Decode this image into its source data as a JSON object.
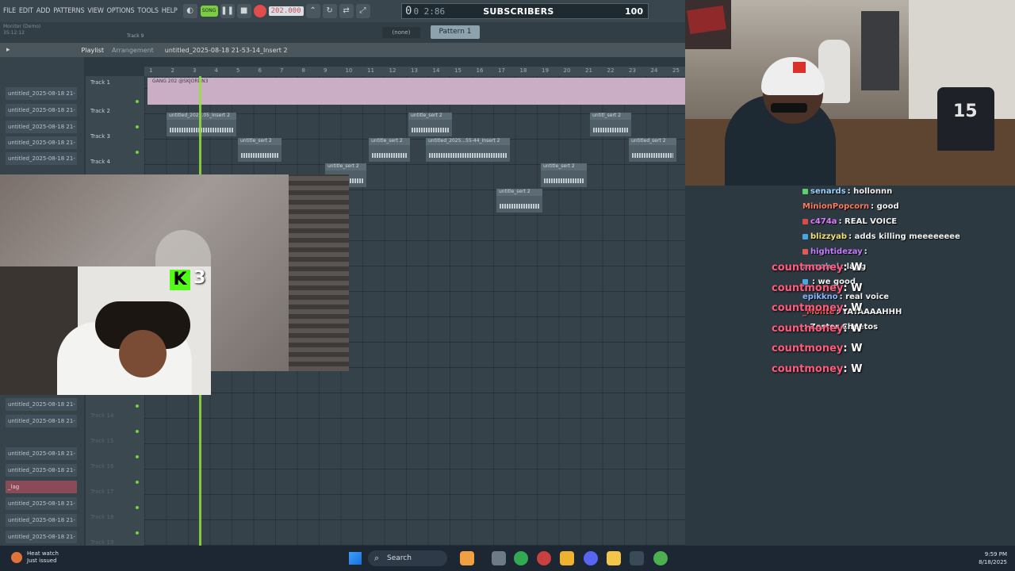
{
  "menu": [
    "FILE",
    "EDIT",
    "ADD",
    "PATTERNS",
    "VIEW",
    "OPTIONS",
    "TOOLS",
    "HELP"
  ],
  "transport": {
    "song_label": "SONG",
    "bpm": "202.000",
    "time_main": "0",
    "time_sub": "0 2:86",
    "subscribers_label": "SUBSCRIBERS",
    "volume": "100"
  },
  "toolbar2": {
    "hint_line1": "Monitor (Demo)",
    "hint_line2": "35:12:12",
    "track_hint": "Track 9",
    "none_select": "(none)",
    "pattern_select": "Pattern 1"
  },
  "playlist": {
    "title": "Playlist",
    "subtitle": "Arrangement",
    "file": "untitled_2025-08-18 21-53-14_Insert 2",
    "track1_clip": "GANG 202 @SKJORDN3"
  },
  "ruler": [
    "1",
    "2",
    "3",
    "4",
    "5",
    "6",
    "7",
    "8",
    "9",
    "10",
    "11",
    "12",
    "13",
    "14",
    "15",
    "16",
    "17",
    "18",
    "19",
    "20",
    "21",
    "22",
    "23",
    "24",
    "25"
  ],
  "browser": {
    "top_items": [
      "untitled_2025-08-18 21-",
      "untitled_2025-08-18 21-",
      "untitled_2025-08-18 21-",
      "untitled_2025-08-18 21-",
      "untitled_2025-08-18 21-",
      "untitled_2025-08-18 21-"
    ],
    "bottom_items": [
      "untitled_2025-08-18 21-",
      "untitled_2025-08-18 21-",
      "untitled_2025-08-18 21-",
      "untitled_2025-08-18 21-",
      "_lag",
      "untitled_2025-08-18 21-",
      "untitled_2025-08-18 21-",
      "untitled_2025-08-18 21-"
    ]
  },
  "tracks": {
    "visible": [
      "Track 1",
      "Track 2",
      "Track 3",
      "Track 4"
    ],
    "dim": [
      "Track 14",
      "Track 15",
      "Track 16",
      "Track 17",
      "Track 18",
      "Track 19"
    ]
  },
  "clips": [
    {
      "name": "untitled_202...05_Insert 2"
    },
    {
      "name": "untitle_sert 2"
    },
    {
      "name": "untitl_sert 2"
    },
    {
      "name": "untitle_sert 2"
    },
    {
      "name": "untitle_sert 2"
    },
    {
      "name": "untitled_2025...55-44_Insert 2"
    },
    {
      "name": "untitled_sert 2"
    },
    {
      "name": "untitle_sert 2"
    },
    {
      "name": "untitle_sert 2"
    },
    {
      "name": "untitle_sert 2"
    }
  ],
  "webcam": {
    "jersey_number": "15"
  },
  "kick": {
    "logo": "K",
    "viewers": "3"
  },
  "chat": [
    {
      "user": "senards",
      "msg": "hollonnn",
      "color": "#9ad2ff",
      "badge": "#5bd16d"
    },
    {
      "user": "MinionPopcorn",
      "msg": "good",
      "color": "#ff7a5c",
      "badge": ""
    },
    {
      "user": "c474a",
      "msg": "REAL VOICE",
      "color": "#e07cff",
      "badge": "#d94a4a"
    },
    {
      "user": "blizzyab",
      "msg": "adds killing meeeeeeee",
      "color": "#f5e070",
      "badge": "#4aa6e0"
    },
    {
      "user": "hightidezay",
      "msg": "",
      "color": "#c57cff",
      "badge": "#e05a5a"
    },
    {
      "user": "rcruzbol",
      "msg": "lagg",
      "color": "#7fb6ff",
      "badge": ""
    },
    {
      "user": "",
      "msg": "we good",
      "color": "#ff6a6a",
      "badge": "#4aa6e0"
    },
    {
      "user": "epikkno",
      "msg": "real voice",
      "color": "#8ab4ff",
      "badge": ""
    },
    {
      "user": "_Monte",
      "msg": "YAYAAAAHHH",
      "color": "#ff6060",
      "badge": ""
    },
    {
      "user": "",
      "msg": "Zester Cheetos",
      "color": "#5ad17a",
      "badge": ""
    }
  ],
  "w_feed": [
    {
      "user": "countmoney",
      "msg": ": W"
    },
    {
      "user": "countmoney",
      "msg": ": W"
    },
    {
      "user": "countmoney",
      "msg": ": W"
    },
    {
      "user": "countmoney",
      "msg": ": W"
    },
    {
      "user": "countmoney",
      "msg": ": W"
    },
    {
      "user": "countmoney",
      "msg": ": W"
    }
  ],
  "taskbar": {
    "weather_title": "Heat watch",
    "weather_sub": "Just issued",
    "search": "Search",
    "time": "9:59 PM",
    "date": "8/18/2025"
  }
}
